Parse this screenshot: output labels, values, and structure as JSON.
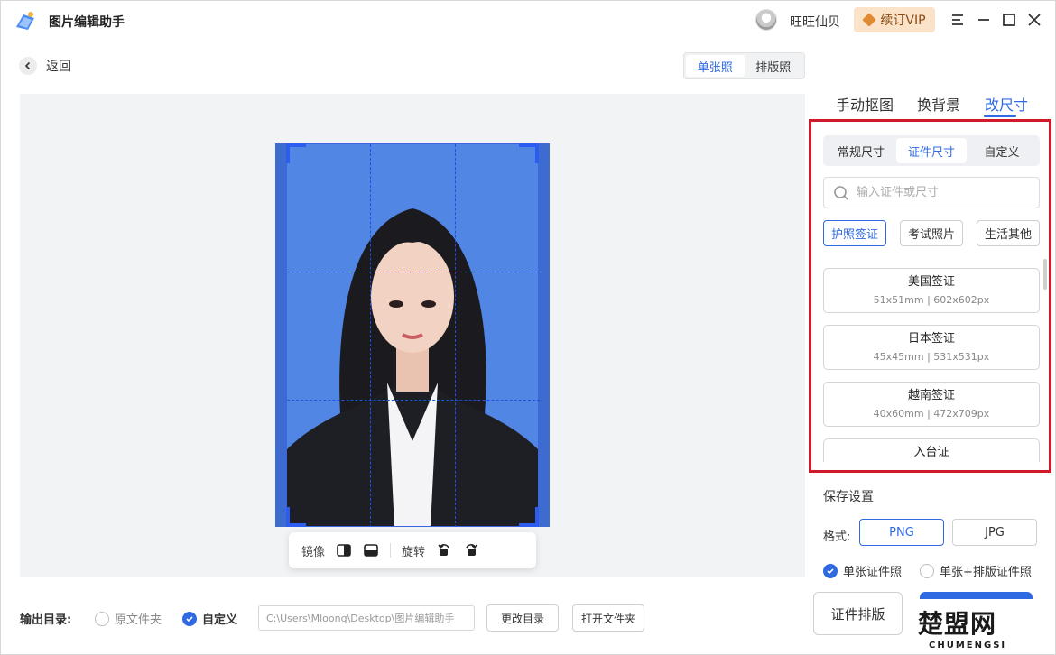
{
  "app": {
    "title": "图片编辑助手"
  },
  "user": {
    "name": "旺旺仙贝"
  },
  "vip": {
    "label": "续订VIP"
  },
  "nav": {
    "back_label": "返回"
  },
  "mode_tabs": [
    {
      "label": "单张照",
      "active": true
    },
    {
      "label": "排版照",
      "active": false
    }
  ],
  "edit_tabs": [
    {
      "label": "手动抠图",
      "active": false
    },
    {
      "label": "换背景",
      "active": false
    },
    {
      "label": "改尺寸",
      "active": true
    }
  ],
  "size_subtabs": [
    {
      "label": "常规尺寸",
      "active": false
    },
    {
      "label": "证件尺寸",
      "active": true
    },
    {
      "label": "自定义",
      "active": false
    }
  ],
  "search": {
    "placeholder": "输入证件或尺寸"
  },
  "categories": [
    {
      "label": "护照签证",
      "active": true
    },
    {
      "label": "考试照片",
      "active": false
    },
    {
      "label": "生活其他",
      "active": false
    }
  ],
  "size_list": [
    {
      "name": "美国签证",
      "spec": "51x51mm | 602x602px"
    },
    {
      "name": "日本签证",
      "spec": "45x45mm | 531x531px"
    },
    {
      "name": "越南签证",
      "spec": "40x60mm | 472x709px"
    },
    {
      "name": "入台证",
      "spec": ""
    }
  ],
  "image_tools": {
    "mirror_label": "镜像",
    "rotate_label": "旋转"
  },
  "save_settings": {
    "title": "保存设置",
    "format_label": "格式:",
    "formats": [
      {
        "label": "PNG",
        "active": true
      },
      {
        "label": "JPG",
        "active": false
      }
    ],
    "options": [
      {
        "label": "单张证件照",
        "checked": true
      },
      {
        "label": "单张+排版证件照",
        "checked": false
      }
    ]
  },
  "actions": {
    "layout_label": "证件排版"
  },
  "output": {
    "label": "输出目录:",
    "option_source": "原文件夹",
    "option_custom": "自定义",
    "path": "C:\\Users\\Mloong\\Desktop\\图片编辑助手",
    "change_label": "更改目录",
    "open_label": "打开文件夹"
  },
  "watermark": {
    "text": "楚盟网",
    "sub": "CHUMENGSI"
  },
  "colors": {
    "accent": "#2f6ae3",
    "highlight_border": "#d01a2a",
    "photo_bg": "#5186e4",
    "vip_bg": "#fae3c9"
  }
}
